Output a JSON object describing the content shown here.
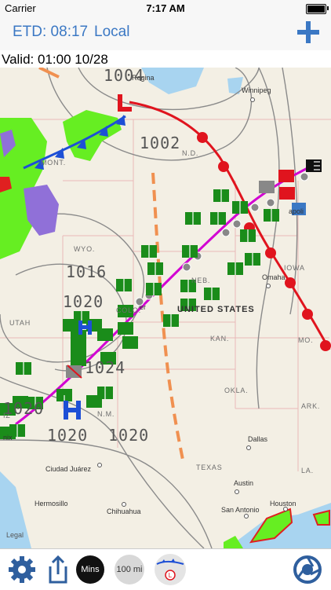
{
  "status": {
    "carrier": "Carrier",
    "time": "7:17 AM"
  },
  "nav": {
    "etd": "ETD: 08:17",
    "local": "Local"
  },
  "valid": "Valid: 01:00 10/28",
  "map": {
    "cities": [
      "Regina",
      "Winnipeg",
      "Omaha",
      "Dallas",
      "Austin",
      "San Antonio",
      "Houston",
      "Ciudad Juárez",
      "Hermosillo",
      "Chihuahua"
    ],
    "states": [
      "MONT.",
      "N.D.",
      "WYO.",
      "NEB.",
      "IOWA",
      "UTAH",
      "COLO.",
      "KAN.",
      "MO.",
      "OKLA.",
      "ARK.",
      "N.M.",
      "TEXAS",
      "LA.",
      "IZ",
      "nix"
    ],
    "country": "UNITED STATES",
    "isobars": [
      "1004",
      "1002",
      "1016",
      "1020",
      "1024",
      "1020",
      "1020",
      "1020"
    ],
    "pressure_centers": [
      "L",
      "H",
      "H"
    ],
    "city_fragments": [
      "apoli",
      "er"
    ],
    "legal": "Legal"
  },
  "toolbar": {
    "mins": "Mins",
    "distance": "100 mi",
    "radar_letter": "L"
  },
  "colors": {
    "accent": "#3b78c4",
    "route": "#d200d2",
    "cold_front": "#1d4fd6",
    "warm_front": "#e0141e",
    "vfr": "#1a8c1a",
    "ifr": "#e0141e"
  }
}
